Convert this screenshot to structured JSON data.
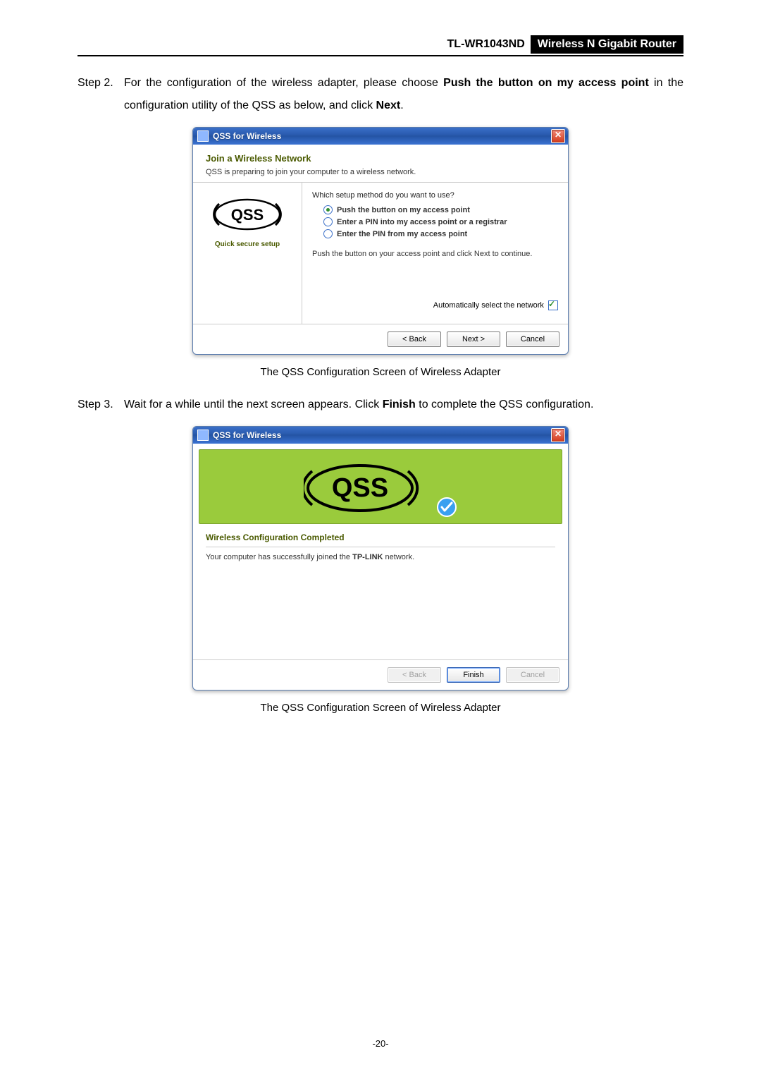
{
  "header": {
    "model": "TL-WR1043ND",
    "tagline": "Wireless N Gigabit Router"
  },
  "step2": {
    "label": "Step 2.",
    "text_parts": {
      "t1": "For the configuration of the wireless adapter, please choose ",
      "bold1": "Push the button on my access point",
      "t2": " in the configuration utility of the QSS as below, and click ",
      "bold2": "Next",
      "t3": "."
    }
  },
  "dialog1": {
    "title": "QSS for Wireless",
    "heading": "Join a Wireless Network",
    "sub": "QSS is preparing to join your computer to a wireless network.",
    "sidebar_caption": "Quick secure setup",
    "prompt": "Which setup method do you want to use?",
    "options": {
      "opt1": "Push the button on my access point",
      "opt2": "Enter a PIN into my access point or a registrar",
      "opt3": "Enter the PIN from my access point"
    },
    "instruction": "Push the button on your access point and click Next to continue.",
    "auto_label": "Automatically select the network",
    "buttons": {
      "back": "< Back",
      "next": "Next >",
      "cancel": "Cancel"
    }
  },
  "caption1": "The QSS Configuration Screen of Wireless Adapter",
  "step3": {
    "label": "Step 3.",
    "text_parts": {
      "t1": "Wait for a while until the next screen appears. Click ",
      "bold1": "Finish",
      "t2": " to complete the QSS configuration."
    }
  },
  "dialog2": {
    "title": "QSS for Wireless",
    "heading": "Wireless Configuration Completed",
    "msg_parts": {
      "t1": "Your computer has successfully joined the ",
      "bold1": "TP-LINK",
      "t2": " network."
    },
    "buttons": {
      "back": "< Back",
      "finish": "Finish",
      "cancel": "Cancel"
    }
  },
  "caption2": "The QSS Configuration Screen of Wireless Adapter",
  "page_number": "-20-"
}
